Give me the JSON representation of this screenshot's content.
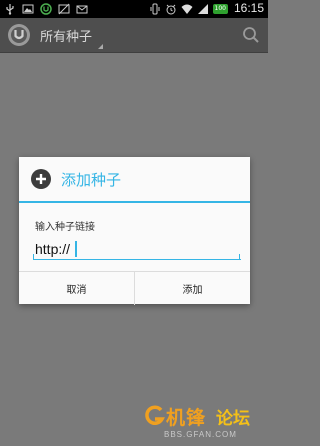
{
  "status_bar": {
    "time": "16:15",
    "battery_label": "100",
    "icons_left": [
      "usb-icon",
      "image-icon",
      "utorrent-icon",
      "no-image-icon",
      "mail-icon"
    ],
    "icons_right": [
      "vibrate-icon",
      "alarm-icon",
      "wifi-icon",
      "signal-icon",
      "battery-icon"
    ]
  },
  "action_bar": {
    "title": "所有种子",
    "app_icon": "utorrent-logo-icon",
    "search_icon": "search-icon"
  },
  "dialog": {
    "title": "添加种子",
    "title_icon": "plus-circle-icon",
    "field_label": "输入种子链接",
    "input_value": "http://",
    "cancel_label": "取消",
    "add_label": "添加"
  },
  "watermark": {
    "text_main": "机锋",
    "text_forum": "论坛",
    "url": "BBS.GFAN.COM"
  },
  "colors": {
    "accent": "#35b5e5",
    "dim_background": "#7a7a7a",
    "action_bar": "#4e4e4e",
    "status_bar": "#000000",
    "dialog_bg": "#fafafa",
    "watermark_orange": "#f0a020"
  }
}
